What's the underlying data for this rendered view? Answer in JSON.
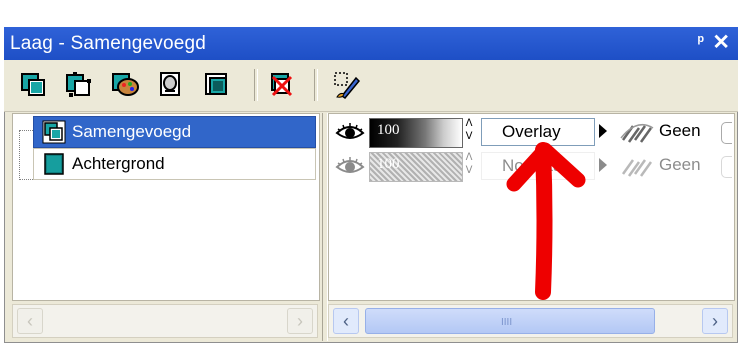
{
  "window": {
    "title": "Laag - Samengevoegd",
    "pin_icon": "pin-icon",
    "close_label": "✕"
  },
  "toolbar": {
    "buttons": [
      {
        "name": "new-raster-layer-icon"
      },
      {
        "name": "new-vector-layer-icon"
      },
      {
        "name": "new-art-media-layer-icon"
      },
      {
        "name": "new-mask-layer-icon"
      },
      {
        "name": "new-adjustment-layer-icon"
      },
      {
        "name": "delete-layer-icon"
      },
      {
        "name": "edit-selection-icon"
      }
    ]
  },
  "layers": [
    {
      "name": "Samengevoegd",
      "selected": true
    },
    {
      "name": "Achtergrond",
      "selected": false
    }
  ],
  "properties": [
    {
      "opacity": "100",
      "blend_mode": "Overlay",
      "link": "Geen"
    },
    {
      "opacity": "100",
      "blend_mode": "Normaal",
      "link": "Geen"
    }
  ],
  "colors": {
    "titlebar": "#2f62d8",
    "selected_row": "#3166c9",
    "annotation_arrow": "#ee0000"
  }
}
